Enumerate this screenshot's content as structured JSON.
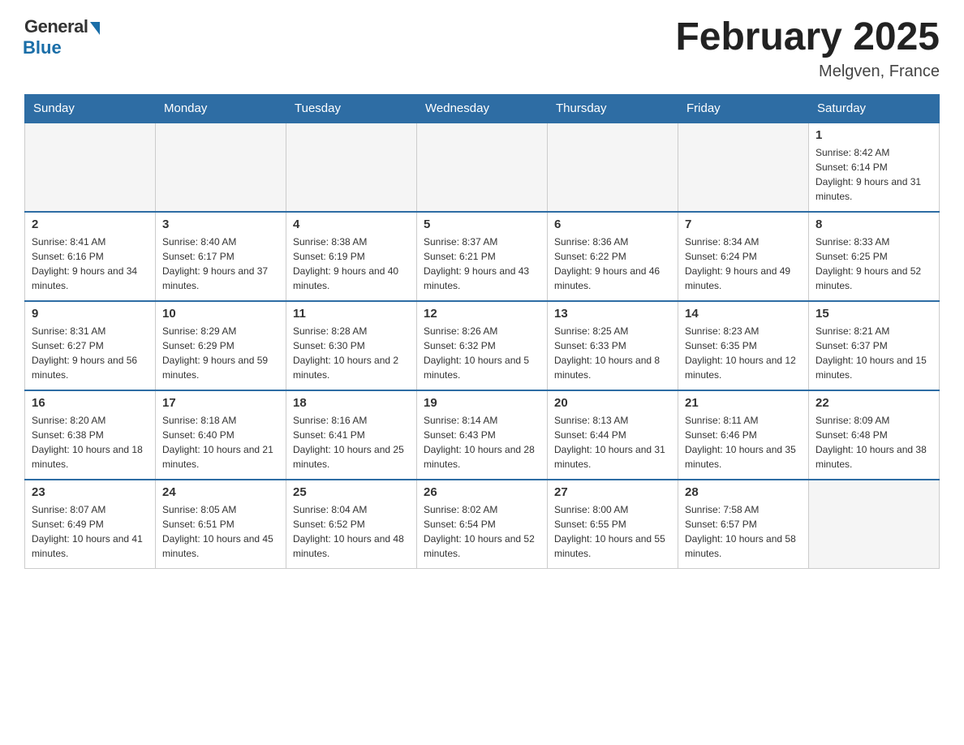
{
  "header": {
    "logo_general": "General",
    "logo_blue": "Blue",
    "month_title": "February 2025",
    "location": "Melgven, France"
  },
  "weekdays": [
    "Sunday",
    "Monday",
    "Tuesday",
    "Wednesday",
    "Thursday",
    "Friday",
    "Saturday"
  ],
  "weeks": [
    [
      {
        "day": "",
        "info": ""
      },
      {
        "day": "",
        "info": ""
      },
      {
        "day": "",
        "info": ""
      },
      {
        "day": "",
        "info": ""
      },
      {
        "day": "",
        "info": ""
      },
      {
        "day": "",
        "info": ""
      },
      {
        "day": "1",
        "info": "Sunrise: 8:42 AM\nSunset: 6:14 PM\nDaylight: 9 hours and 31 minutes."
      }
    ],
    [
      {
        "day": "2",
        "info": "Sunrise: 8:41 AM\nSunset: 6:16 PM\nDaylight: 9 hours and 34 minutes."
      },
      {
        "day": "3",
        "info": "Sunrise: 8:40 AM\nSunset: 6:17 PM\nDaylight: 9 hours and 37 minutes."
      },
      {
        "day": "4",
        "info": "Sunrise: 8:38 AM\nSunset: 6:19 PM\nDaylight: 9 hours and 40 minutes."
      },
      {
        "day": "5",
        "info": "Sunrise: 8:37 AM\nSunset: 6:21 PM\nDaylight: 9 hours and 43 minutes."
      },
      {
        "day": "6",
        "info": "Sunrise: 8:36 AM\nSunset: 6:22 PM\nDaylight: 9 hours and 46 minutes."
      },
      {
        "day": "7",
        "info": "Sunrise: 8:34 AM\nSunset: 6:24 PM\nDaylight: 9 hours and 49 minutes."
      },
      {
        "day": "8",
        "info": "Sunrise: 8:33 AM\nSunset: 6:25 PM\nDaylight: 9 hours and 52 minutes."
      }
    ],
    [
      {
        "day": "9",
        "info": "Sunrise: 8:31 AM\nSunset: 6:27 PM\nDaylight: 9 hours and 56 minutes."
      },
      {
        "day": "10",
        "info": "Sunrise: 8:29 AM\nSunset: 6:29 PM\nDaylight: 9 hours and 59 minutes."
      },
      {
        "day": "11",
        "info": "Sunrise: 8:28 AM\nSunset: 6:30 PM\nDaylight: 10 hours and 2 minutes."
      },
      {
        "day": "12",
        "info": "Sunrise: 8:26 AM\nSunset: 6:32 PM\nDaylight: 10 hours and 5 minutes."
      },
      {
        "day": "13",
        "info": "Sunrise: 8:25 AM\nSunset: 6:33 PM\nDaylight: 10 hours and 8 minutes."
      },
      {
        "day": "14",
        "info": "Sunrise: 8:23 AM\nSunset: 6:35 PM\nDaylight: 10 hours and 12 minutes."
      },
      {
        "day": "15",
        "info": "Sunrise: 8:21 AM\nSunset: 6:37 PM\nDaylight: 10 hours and 15 minutes."
      }
    ],
    [
      {
        "day": "16",
        "info": "Sunrise: 8:20 AM\nSunset: 6:38 PM\nDaylight: 10 hours and 18 minutes."
      },
      {
        "day": "17",
        "info": "Sunrise: 8:18 AM\nSunset: 6:40 PM\nDaylight: 10 hours and 21 minutes."
      },
      {
        "day": "18",
        "info": "Sunrise: 8:16 AM\nSunset: 6:41 PM\nDaylight: 10 hours and 25 minutes."
      },
      {
        "day": "19",
        "info": "Sunrise: 8:14 AM\nSunset: 6:43 PM\nDaylight: 10 hours and 28 minutes."
      },
      {
        "day": "20",
        "info": "Sunrise: 8:13 AM\nSunset: 6:44 PM\nDaylight: 10 hours and 31 minutes."
      },
      {
        "day": "21",
        "info": "Sunrise: 8:11 AM\nSunset: 6:46 PM\nDaylight: 10 hours and 35 minutes."
      },
      {
        "day": "22",
        "info": "Sunrise: 8:09 AM\nSunset: 6:48 PM\nDaylight: 10 hours and 38 minutes."
      }
    ],
    [
      {
        "day": "23",
        "info": "Sunrise: 8:07 AM\nSunset: 6:49 PM\nDaylight: 10 hours and 41 minutes."
      },
      {
        "day": "24",
        "info": "Sunrise: 8:05 AM\nSunset: 6:51 PM\nDaylight: 10 hours and 45 minutes."
      },
      {
        "day": "25",
        "info": "Sunrise: 8:04 AM\nSunset: 6:52 PM\nDaylight: 10 hours and 48 minutes."
      },
      {
        "day": "26",
        "info": "Sunrise: 8:02 AM\nSunset: 6:54 PM\nDaylight: 10 hours and 52 minutes."
      },
      {
        "day": "27",
        "info": "Sunrise: 8:00 AM\nSunset: 6:55 PM\nDaylight: 10 hours and 55 minutes."
      },
      {
        "day": "28",
        "info": "Sunrise: 7:58 AM\nSunset: 6:57 PM\nDaylight: 10 hours and 58 minutes."
      },
      {
        "day": "",
        "info": ""
      }
    ]
  ]
}
